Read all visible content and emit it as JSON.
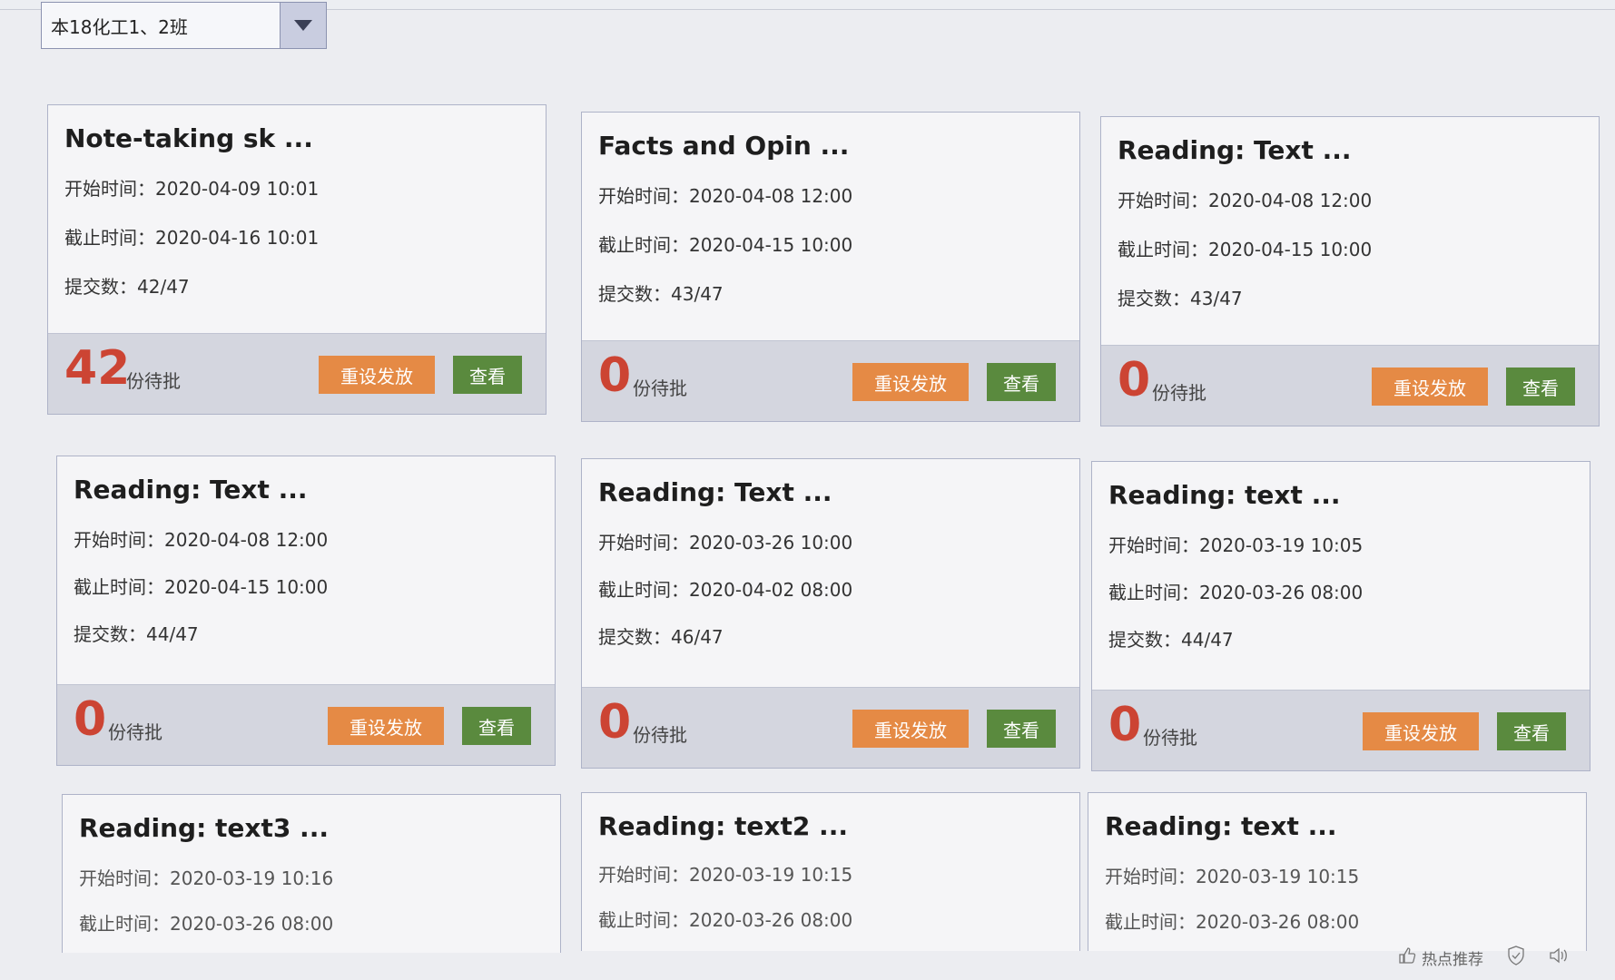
{
  "class_selector": {
    "value": "本18化工1、2班",
    "arrow_icon": "caret-down-icon"
  },
  "labels": {
    "start": "开始时间：",
    "end": "截止时间：",
    "submitted": "提交数：",
    "pending": "份待批",
    "reset": "重设发放",
    "view": "查看"
  },
  "cards": [
    {
      "title": "Note-taking sk ...",
      "start": "2020-04-09 10:01",
      "end": "2020-04-16 10:01",
      "submitted": "42/47",
      "pending": "42"
    },
    {
      "title": "Facts and Opin ...",
      "start": "2020-04-08 12:00",
      "end": "2020-04-15 10:00",
      "submitted": "43/47",
      "pending": "0"
    },
    {
      "title": "Reading: Text ...",
      "start": "2020-04-08 12:00",
      "end": "2020-04-15 10:00",
      "submitted": "43/47",
      "pending": "0"
    },
    {
      "title": "Reading: Text ...",
      "start": "2020-04-08 12:00",
      "end": "2020-04-15 10:00",
      "submitted": "44/47",
      "pending": "0"
    },
    {
      "title": "Reading: Text ...",
      "start": "2020-03-26 10:00",
      "end": "2020-04-02 08:00",
      "submitted": "46/47",
      "pending": "0"
    },
    {
      "title": "Reading: text ...",
      "start": "2020-03-19 10:05",
      "end": "2020-03-26 08:00",
      "submitted": "44/47",
      "pending": "0"
    },
    {
      "title": "Reading: text3 ...",
      "start": "2020-03-19 10:16",
      "end": "2020-03-26 08:00"
    },
    {
      "title": "Reading: text2 ...",
      "start": "2020-03-19 10:15",
      "end": "2020-03-26 08:00"
    },
    {
      "title": "Reading: text ...",
      "start": "2020-03-19 10:15",
      "end": "2020-03-26 08:00"
    }
  ],
  "statusbar": {
    "hot_label": "热点推荐",
    "hot_icon": "thumb-icon",
    "shield_icon": "shield-icon",
    "speaker_icon": "speaker-icon"
  },
  "colors": {
    "pending_number": "#cc4433",
    "reset_button": "#e58a45",
    "view_button": "#5a8a3e"
  }
}
